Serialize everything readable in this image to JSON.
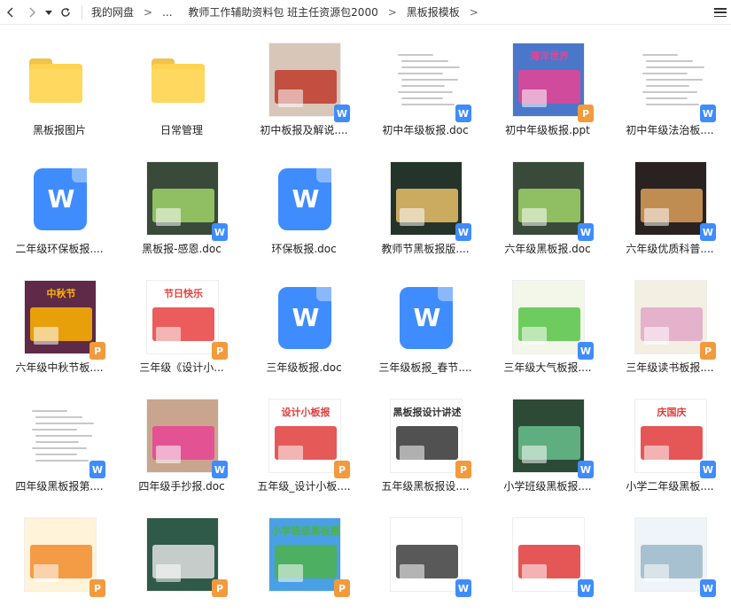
{
  "breadcrumb": [
    "我的网盘",
    "...",
    "教师工作辅助资料包 班主任资源包2000",
    "黑板报模板"
  ],
  "files": [
    {
      "name": "黑板报图片",
      "kind": "folder"
    },
    {
      "name": "日常管理",
      "kind": "folder"
    },
    {
      "name": "初中板报及解说....",
      "kind": "word-preview"
    },
    {
      "name": "初中年级板报.doc",
      "kind": "word-preview"
    },
    {
      "name": "初中年级板报.ppt",
      "kind": "ppt-preview"
    },
    {
      "name": "初中年级法治板....",
      "kind": "word-preview"
    },
    {
      "name": "二年级环保板报....",
      "kind": "word-icon"
    },
    {
      "name": "黑板报-感恩.doc",
      "kind": "word-preview"
    },
    {
      "name": "环保板报.doc",
      "kind": "word-icon"
    },
    {
      "name": "教师节黑板报版....",
      "kind": "word-preview"
    },
    {
      "name": "六年级黑板报.doc",
      "kind": "word-preview"
    },
    {
      "name": "六年级优质科普....",
      "kind": "word-preview"
    },
    {
      "name": "六年级中秋节板....",
      "kind": "ppt-preview"
    },
    {
      "name": "三年级《设计小...",
      "kind": "ppt-preview"
    },
    {
      "name": "三年级板报.doc",
      "kind": "word-icon"
    },
    {
      "name": "三年级板报_春节....",
      "kind": "word-icon"
    },
    {
      "name": "三年级大气板报....",
      "kind": "word-preview"
    },
    {
      "name": "三年级读书板报....",
      "kind": "ppt-preview"
    },
    {
      "name": "四年级黑板报第....",
      "kind": "word-preview"
    },
    {
      "name": "四年级手抄报.doc",
      "kind": "word-preview"
    },
    {
      "name": "五年级_设计小板....",
      "kind": "ppt-preview"
    },
    {
      "name": "五年级黑板报设....",
      "kind": "ppt-preview"
    },
    {
      "name": "小学班级黑板报....",
      "kind": "word-preview"
    },
    {
      "name": "小学二年级黑板....",
      "kind": "word-preview"
    },
    {
      "name": "",
      "kind": "ppt-preview"
    },
    {
      "name": "",
      "kind": "ppt-preview"
    },
    {
      "name": "",
      "kind": "ppt-preview"
    },
    {
      "name": "",
      "kind": "word-preview"
    },
    {
      "name": "",
      "kind": "word-preview"
    },
    {
      "name": "",
      "kind": "word-preview"
    }
  ],
  "thumbnails": {
    "2": {
      "bg": "#d8c7b8",
      "accent": "#c0392b",
      "text": ""
    },
    "4": {
      "bg": "#4a77c9",
      "accent": "#e84393",
      "text": "海洋世界"
    },
    "7": {
      "bg": "#3a4a3a",
      "accent": "#a0d468",
      "text": ""
    },
    "9": {
      "bg": "#25342a",
      "accent": "#e8c16a",
      "text": ""
    },
    "10": {
      "bg": "#3a4a3a",
      "accent": "#a0d468",
      "text": ""
    },
    "11": {
      "bg": "#2a2220",
      "accent": "#d9a05b",
      "text": ""
    },
    "12": {
      "bg": "#5e2a48",
      "accent": "#ffb400",
      "text": "中秋节"
    },
    "13": {
      "bg": "#ffffff",
      "accent": "#e84040",
      "text": "节日快乐"
    },
    "16": {
      "bg": "#f2f7ea",
      "accent": "#57c445",
      "text": ""
    },
    "17": {
      "bg": "#f4efe3",
      "accent": "#e1a7c7",
      "text": ""
    },
    "19": {
      "bg": "#c9a58e",
      "accent": "#e84393",
      "text": ""
    },
    "20": {
      "bg": "#ffffff",
      "accent": "#e13c3c",
      "text": "设计小板报"
    },
    "21": {
      "bg": "#ffffff",
      "accent": "#333333",
      "text": "黑板报设计讲述"
    },
    "22": {
      "bg": "#2c4a36",
      "accent": "#68c08c",
      "text": ""
    },
    "23": {
      "bg": "#ffffff",
      "accent": "#e03a3a",
      "text": "庆国庆"
    },
    "24": {
      "bg": "#fff4d9",
      "accent": "#f28b2c",
      "text": ""
    },
    "25": {
      "bg": "#2f5a4a",
      "accent": "#e0e0e0",
      "text": ""
    },
    "26": {
      "bg": "#4aa0e4",
      "accent": "#4db24a",
      "text": "小学班级黑板报"
    },
    "27": {
      "bg": "#ffffff",
      "accent": "#3c3c3c",
      "text": ""
    },
    "28": {
      "bg": "#ffffff",
      "accent": "#e03a3a",
      "text": ""
    },
    "29": {
      "bg": "#eef4f7",
      "accent": "#9bb7c9",
      "text": ""
    }
  }
}
